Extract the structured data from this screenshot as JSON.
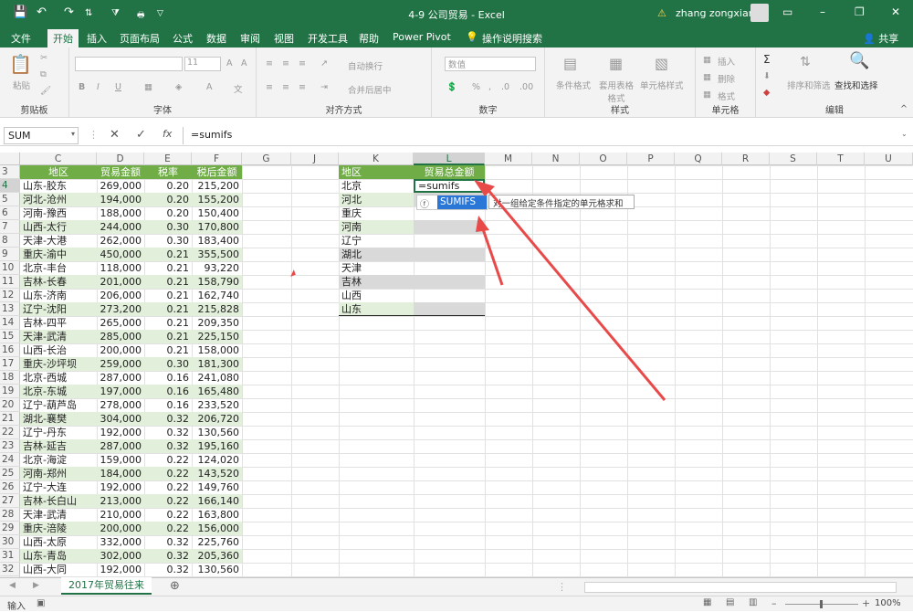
{
  "window": {
    "title": "4-9 公司贸易 - Excel",
    "user": "zhang zongxian"
  },
  "tabs": [
    "文件",
    "开始",
    "插入",
    "页面布局",
    "公式",
    "数据",
    "审阅",
    "视图",
    "开发工具",
    "帮助",
    "Power Pivot",
    "操作说明搜索"
  ],
  "share": "共享",
  "ribbon": {
    "clipboard": {
      "label": "剪贴板",
      "paste": "粘贴"
    },
    "font": {
      "label": "字体",
      "size": "11"
    },
    "alignment": {
      "label": "对齐方式",
      "wrap": "自动换行",
      "merge": "合并后居中"
    },
    "number": {
      "label": "数字",
      "format": "数值"
    },
    "styles": {
      "label": "样式",
      "cond": "条件格式",
      "table": "套用表格格式",
      "cell": "单元格样式"
    },
    "cells": {
      "label": "单元格",
      "insert": "插入",
      "delete": "删除",
      "format": "格式"
    },
    "editing": {
      "label": "编辑",
      "sort": "排序和筛选",
      "find": "查找和选择"
    }
  },
  "formula_bar": {
    "name_box": "SUM",
    "fx": "fx",
    "content": "=sumifs"
  },
  "columns": [
    "C",
    "D",
    "E",
    "F",
    "G",
    "J",
    "K",
    "L",
    "M",
    "N",
    "O",
    "P",
    "Q",
    "R",
    "S",
    "T",
    "U",
    "V"
  ],
  "header_row": {
    "c": "地区",
    "d": "贸易金额",
    "e": "税率",
    "f": "税后金额"
  },
  "rows": [
    {
      "n": "4",
      "c": "山东-胶东",
      "d": "269,000",
      "e": "0.20",
      "f": "215,200"
    },
    {
      "n": "5",
      "c": "河北-沧州",
      "d": "194,000",
      "e": "0.20",
      "f": "155,200"
    },
    {
      "n": "6",
      "c": "河南-豫西",
      "d": "188,000",
      "e": "0.20",
      "f": "150,400"
    },
    {
      "n": "7",
      "c": "山西-太行",
      "d": "244,000",
      "e": "0.30",
      "f": "170,800"
    },
    {
      "n": "8",
      "c": "天津-大港",
      "d": "262,000",
      "e": "0.30",
      "f": "183,400"
    },
    {
      "n": "9",
      "c": "重庆-渝中",
      "d": "450,000",
      "e": "0.21",
      "f": "355,500"
    },
    {
      "n": "10",
      "c": "北京-丰台",
      "d": "118,000",
      "e": "0.21",
      "f": "93,220"
    },
    {
      "n": "11",
      "c": "吉林-长春",
      "d": "201,000",
      "e": "0.21",
      "f": "158,790"
    },
    {
      "n": "12",
      "c": "山东-济南",
      "d": "206,000",
      "e": "0.21",
      "f": "162,740"
    },
    {
      "n": "13",
      "c": "辽宁-沈阳",
      "d": "273,200",
      "e": "0.21",
      "f": "215,828"
    },
    {
      "n": "14",
      "c": "吉林-四平",
      "d": "265,000",
      "e": "0.21",
      "f": "209,350"
    },
    {
      "n": "15",
      "c": "天津-武清",
      "d": "285,000",
      "e": "0.21",
      "f": "225,150"
    },
    {
      "n": "16",
      "c": "山西-长治",
      "d": "200,000",
      "e": "0.21",
      "f": "158,000"
    },
    {
      "n": "17",
      "c": "重庆-沙坪坝",
      "d": "259,000",
      "e": "0.30",
      "f": "181,300"
    },
    {
      "n": "18",
      "c": "北京-西城",
      "d": "287,000",
      "e": "0.16",
      "f": "241,080"
    },
    {
      "n": "19",
      "c": "北京-东城",
      "d": "197,000",
      "e": "0.16",
      "f": "165,480"
    },
    {
      "n": "20",
      "c": "辽宁-葫芦岛",
      "d": "278,000",
      "e": "0.16",
      "f": "233,520"
    },
    {
      "n": "21",
      "c": "湖北-襄樊",
      "d": "304,000",
      "e": "0.32",
      "f": "206,720"
    },
    {
      "n": "22",
      "c": "辽宁-丹东",
      "d": "192,000",
      "e": "0.32",
      "f": "130,560"
    },
    {
      "n": "23",
      "c": "吉林-延吉",
      "d": "287,000",
      "e": "0.32",
      "f": "195,160"
    },
    {
      "n": "24",
      "c": "北京-海淀",
      "d": "159,000",
      "e": "0.22",
      "f": "124,020"
    },
    {
      "n": "25",
      "c": "河南-郑州",
      "d": "184,000",
      "e": "0.22",
      "f": "143,520"
    },
    {
      "n": "26",
      "c": "辽宁-大连",
      "d": "192,000",
      "e": "0.22",
      "f": "149,760"
    },
    {
      "n": "27",
      "c": "吉林-长白山",
      "d": "213,000",
      "e": "0.22",
      "f": "166,140"
    },
    {
      "n": "28",
      "c": "天津-武清",
      "d": "210,000",
      "e": "0.22",
      "f": "163,800"
    },
    {
      "n": "29",
      "c": "重庆-涪陵",
      "d": "200,000",
      "e": "0.22",
      "f": "156,000"
    },
    {
      "n": "30",
      "c": "山西-太原",
      "d": "332,000",
      "e": "0.32",
      "f": "225,760"
    },
    {
      "n": "31",
      "c": "山东-青岛",
      "d": "302,000",
      "e": "0.32",
      "f": "205,360"
    },
    {
      "n": "32",
      "c": "山西-大同",
      "d": "192,000",
      "e": "0.32",
      "f": "130,560"
    }
  ],
  "summary": {
    "header_l": "地区",
    "header_m": "贸易总金额",
    "edit_value": "=sumifs",
    "regions": [
      "北京",
      "河北",
      "重庆",
      "河南",
      "辽宁",
      "湖北",
      "天津",
      "吉林",
      "山西",
      "山东"
    ]
  },
  "autocomplete": {
    "item": "SUMIFS",
    "tooltip": "对一组给定条件指定的单元格求和"
  },
  "sheet": {
    "tab": "2017年贸易往来"
  },
  "status": {
    "mode": "输入",
    "zoom": "100%"
  }
}
